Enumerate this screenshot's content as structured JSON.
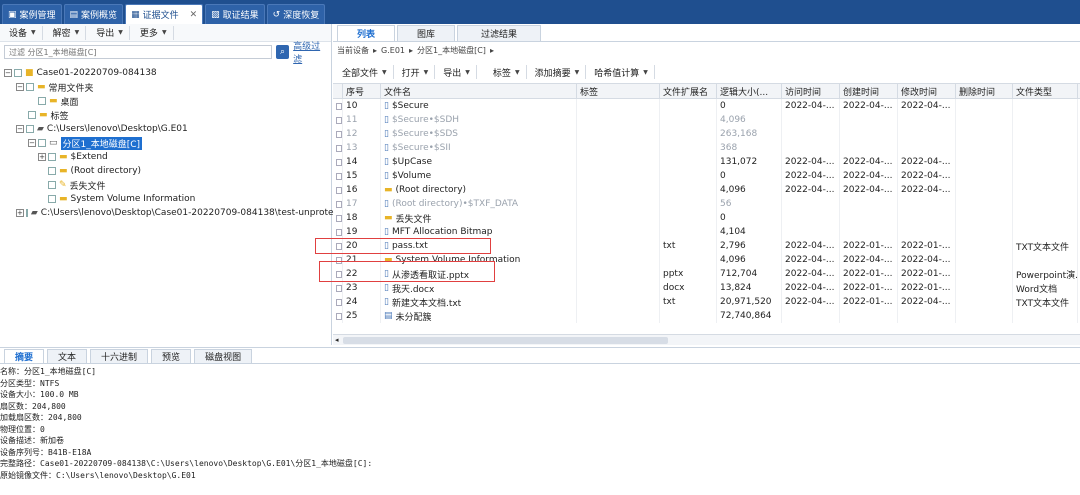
{
  "tabs": [
    {
      "label": "案例管理",
      "icon": "case-manage-icon"
    },
    {
      "label": "案例概览",
      "icon": "overview-icon"
    },
    {
      "label": "证据文件",
      "icon": "evidence-icon"
    },
    {
      "label": "取证结果",
      "icon": "result-icon"
    },
    {
      "label": "深度恢复",
      "icon": "recover-icon"
    }
  ],
  "left_toolbar": {
    "device": "设备",
    "decode": "解密",
    "export": "导出",
    "more": "更多"
  },
  "filter": {
    "placeholder": "过滤 分区1_本地磁盘[C]",
    "advanced": "高级过滤"
  },
  "tree": {
    "root": "Case01-20220709-084138",
    "common": "常用文件夹",
    "desktop": "桌面",
    "tags": "标签",
    "image": "C:\\Users\\lenovo\\Desktop\\G.E01",
    "partition": "分区1_本地磁盘[C]",
    "extend": "$Extend",
    "rootdir": "(Root directory)",
    "lost": "丢失文件",
    "svi": "System Volume Information",
    "image2": "C:\\Users\\lenovo\\Desktop\\Case01-20220709-084138\\test-unprote"
  },
  "right_tabs": [
    "列表",
    "图库",
    "过滤结果"
  ],
  "breadcrumb": [
    "当前设备",
    "G.E01",
    "分区1_本地磁盘[C]"
  ],
  "content_toolbar": {
    "all_files": "全部文件",
    "open": "打开",
    "export": "导出",
    "tag": "标签",
    "add_digest": "添加摘要",
    "hash": "哈希值计算"
  },
  "columns": [
    "序号",
    "文件名",
    "标签",
    "文件扩展名",
    "逻辑大小(...",
    "访问时间",
    "创建时间",
    "修改时间",
    "删除时间",
    "文件类型"
  ],
  "rows": [
    {
      "id": "10",
      "name": "$Secure",
      "ext": "",
      "size": "0",
      "access": "2022-04-...",
      "create": "2022-04-...",
      "modify": "2022-04-...",
      "type": "",
      "gray": false,
      "icon": "file"
    },
    {
      "id": "11",
      "name": "$Secure•$SDH",
      "ext": "",
      "size": "4,096",
      "access": "",
      "create": "",
      "modify": "",
      "type": "",
      "gray": true,
      "icon": "file"
    },
    {
      "id": "12",
      "name": "$Secure•$SDS",
      "ext": "",
      "size": "263,168",
      "access": "",
      "create": "",
      "modify": "",
      "type": "",
      "gray": true,
      "icon": "file"
    },
    {
      "id": "13",
      "name": "$Secure•$SII",
      "ext": "",
      "size": "368",
      "access": "",
      "create": "",
      "modify": "",
      "type": "",
      "gray": true,
      "icon": "file"
    },
    {
      "id": "14",
      "name": "$UpCase",
      "ext": "",
      "size": "131,072",
      "access": "2022-04-...",
      "create": "2022-04-...",
      "modify": "2022-04-...",
      "type": "",
      "gray": false,
      "icon": "file"
    },
    {
      "id": "15",
      "name": "$Volume",
      "ext": "",
      "size": "0",
      "access": "2022-04-...",
      "create": "2022-04-...",
      "modify": "2022-04-...",
      "type": "",
      "gray": false,
      "icon": "file"
    },
    {
      "id": "16",
      "name": "(Root directory)",
      "ext": "",
      "size": "4,096",
      "access": "2022-04-...",
      "create": "2022-04-...",
      "modify": "2022-04-...",
      "type": "",
      "gray": false,
      "icon": "folder"
    },
    {
      "id": "17",
      "name": "(Root directory)•$TXF_DATA",
      "ext": "",
      "size": "56",
      "access": "",
      "create": "",
      "modify": "",
      "type": "",
      "gray": true,
      "icon": "file"
    },
    {
      "id": "18",
      "name": "丢失文件",
      "ext": "",
      "size": "0",
      "access": "",
      "create": "",
      "modify": "",
      "type": "",
      "gray": false,
      "icon": "folder"
    },
    {
      "id": "19",
      "name": "MFT Allocation Bitmap",
      "ext": "",
      "size": "4,104",
      "access": "",
      "create": "",
      "modify": "",
      "type": "",
      "gray": false,
      "icon": "file"
    },
    {
      "id": "20",
      "name": "pass.txt",
      "ext": "txt",
      "size": "2,796",
      "access": "2022-04-...",
      "create": "2022-01-...",
      "modify": "2022-01-...",
      "type": "TXT文本文件",
      "gray": false,
      "icon": "file"
    },
    {
      "id": "21",
      "name": "System Volume Information",
      "ext": "",
      "size": "4,096",
      "access": "2022-04-...",
      "create": "2022-04-...",
      "modify": "2022-04-...",
      "type": "",
      "gray": false,
      "icon": "folder"
    },
    {
      "id": "22",
      "name": "从渗透看取证.pptx",
      "ext": "pptx",
      "size": "712,704",
      "access": "2022-04-...",
      "create": "2022-01-...",
      "modify": "2022-01-...",
      "type": "Powerpoint演...",
      "gray": false,
      "icon": "file"
    },
    {
      "id": "23",
      "name": "我天.docx",
      "ext": "docx",
      "size": "13,824",
      "access": "2022-04-...",
      "create": "2022-01-...",
      "modify": "2022-01-...",
      "type": "Word文档",
      "gray": false,
      "icon": "file"
    },
    {
      "id": "24",
      "name": "新建文本文档.txt",
      "ext": "txt",
      "size": "20,971,520",
      "access": "2022-04-...",
      "create": "2022-01-...",
      "modify": "2022-04-...",
      "type": "TXT文本文件",
      "gray": false,
      "icon": "file"
    },
    {
      "id": "25",
      "name": "未分配簇",
      "ext": "",
      "size": "72,740,864",
      "access": "",
      "create": "",
      "modify": "",
      "type": "",
      "gray": false,
      "icon": "list"
    }
  ],
  "bottom_tabs": [
    "摘要",
    "文本",
    "十六进制",
    "预览",
    "磁盘视图"
  ],
  "summary": [
    "名称：分区1_本地磁盘[C]",
    "分区类型：NTFS",
    "设备大小：100.0 MB",
    "扇区数：204,800",
    "加载扇区数：204,800",
    "物理位置：0",
    "设备描述：新加卷",
    "设备序列号：B41B-E18A",
    "完整路径：Case01-20220709-084138\\C:\\Users\\lenovo\\Desktop\\G.E01\\分区1_本地磁盘[C]:",
    "原始镜像文件：C:\\Users\\lenovo\\Desktop\\G.E01"
  ],
  "colors": {
    "accent": "#1f4f8f",
    "selection": "#1e6fd0",
    "highlight": "#e04040"
  }
}
